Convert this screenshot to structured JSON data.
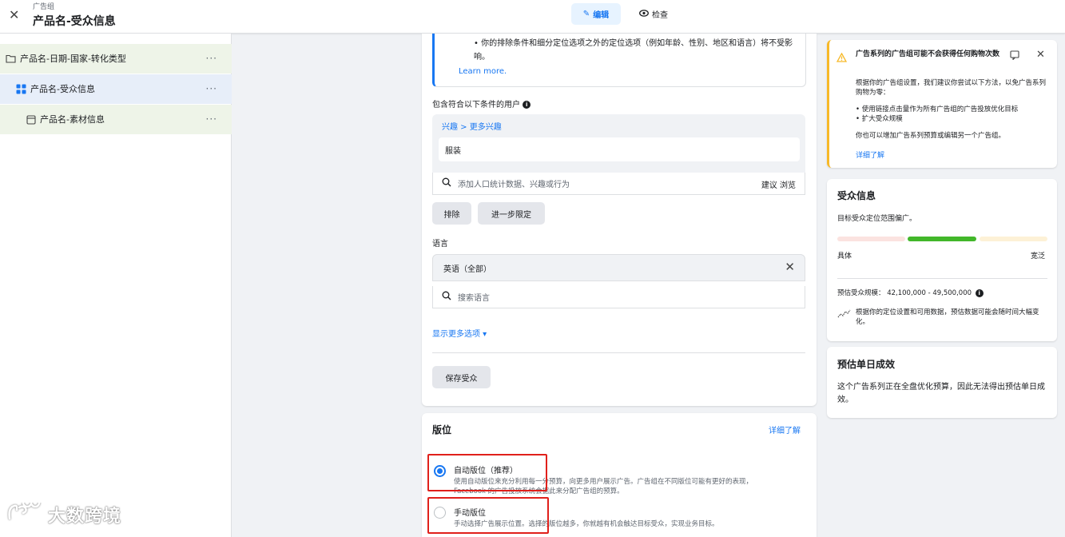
{
  "header": {
    "breadcrumb": "广告组",
    "title": "产品名-受众信息",
    "mode_edit": "编辑",
    "mode_check": "检查"
  },
  "tree": {
    "items": [
      {
        "label": "产品名-日期-国家-转化类型",
        "more": "···"
      },
      {
        "label": "产品名-受众信息",
        "more": "···"
      },
      {
        "label": "产品名-素材信息",
        "more": "···"
      }
    ]
  },
  "targeting": {
    "info_bullet": "你的排除条件和细分定位选项之外的定位选项（例如年龄、性别、地区和语言）将不受影响。",
    "learn_more": "Learn more.",
    "include_label": "包含符合以下条件的用户",
    "interest_path": "兴趣 > 更多兴趣",
    "interest_item": "服装",
    "search_placeholder": "添加人口统计数据、兴趣或行为",
    "suggest": "建议",
    "browse": "浏览",
    "exclude_button": "排除",
    "narrow_button": "进一步限定",
    "language_label": "语言",
    "language_selected": "英语（全部）",
    "language_search_placeholder": "搜索语言",
    "show_more": "显示更多选项 ▾",
    "save_audience": "保存受众"
  },
  "placement": {
    "title": "版位",
    "learn_more": "详细了解",
    "auto_title": "自动版位（推荐）",
    "auto_desc_1": "使用自动版位来充分利用每一分预算，向更多用户展示广告。广告组在不同版位可能有更好的表现，",
    "auto_desc_2": "Facebook 的广告投放系统会据此来分配广告组的预算。",
    "manual_title": "手动版位",
    "manual_desc": "手动选择广告展示位置。选择的版位越多，你就越有机会触达目标受众，实现业务目标。"
  },
  "warning": {
    "title": "广告系列的广告组可能不会获得任何购物次数",
    "text": "根据你的广告组设置，我们建议你尝试以下方法，以免广告系列购物为零：",
    "bullet_1": "使用链接点击量作为所有广告组的广告投放优化目标",
    "bullet_2": "扩大受众规模",
    "text_2": "你也可以增加广告系列预算或编辑另一个广告组。",
    "link": "详细了解"
  },
  "audience": {
    "title": "受众信息",
    "subtitle": "目标受众定位范围偏广。",
    "meter_level": "broad",
    "left_label": "具体",
    "right_label": "宽泛",
    "estimate": "预估受众规模： 42,100,000 - 49,500,000",
    "note": "根据你的定位设置和可用数据，预估数据可能会随时间大幅变化。"
  },
  "estimate": {
    "title": "预估单日成效",
    "text": "这个广告系列正在全盘优化预算，因此无法得出预估单日成效。"
  },
  "watermark": "大数跨境",
  "colors": {
    "accent": "#1877f2",
    "warning": "#f7b928",
    "meter_active": "#42b72a",
    "highlight": "#e0201b"
  }
}
